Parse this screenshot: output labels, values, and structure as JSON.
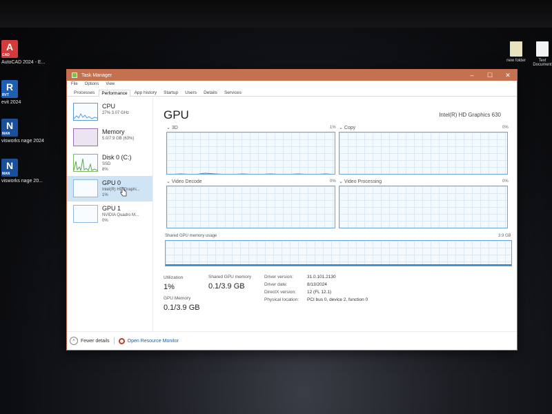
{
  "desktop": {
    "icons": [
      {
        "letter": "A",
        "badge": "CAD",
        "caption": "AutoCAD 2024 - E...",
        "color": "#d33b3b"
      },
      {
        "letter": "R",
        "badge": "RVT",
        "caption": "evit 2024",
        "color": "#1e5fb3"
      },
      {
        "letter": "N",
        "badge": "MAN",
        "caption": "visworks nage 2024",
        "color": "#1a4f9b"
      },
      {
        "letter": "N",
        "badge": "MAN",
        "caption": "visworks nage 20...",
        "color": "#1a4f9b"
      }
    ],
    "right_icons": [
      {
        "caption": "new folder"
      },
      {
        "caption": "Text Document"
      }
    ]
  },
  "window": {
    "title": "Task Manager",
    "controls": {
      "minimize": "–",
      "maximize": "☐",
      "close": "✕"
    },
    "menu": [
      "File",
      "Options",
      "View"
    ],
    "tabs": [
      "Processes",
      "Performance",
      "App history",
      "Startup",
      "Users",
      "Details",
      "Services"
    ],
    "active_tab": "Performance"
  },
  "sidebar": {
    "items": [
      {
        "name": "CPU",
        "sub1": "27%  3.07 GHz",
        "sub2": ""
      },
      {
        "name": "Memory",
        "sub1": "5.0/7.9 GB (63%)",
        "sub2": ""
      },
      {
        "name": "Disk 0 (C:)",
        "sub1": "SSD",
        "sub2": "8%"
      },
      {
        "name": "GPU 0",
        "sub1": "Intel(R) HD Graphi...",
        "sub2": "1%"
      },
      {
        "name": "GPU 1",
        "sub1": "NVIDIA Quadro M...",
        "sub2": "0%"
      }
    ],
    "selected": "GPU 0"
  },
  "main": {
    "heading": "GPU",
    "model": "Intel(R) HD Graphics 630",
    "graphs": [
      {
        "label": "3D",
        "percent": "1%"
      },
      {
        "label": "Copy",
        "percent": "0%"
      },
      {
        "label": "Video Decode",
        "percent": "0%"
      },
      {
        "label": "Video Processing",
        "percent": "0%"
      }
    ],
    "shared_memory": {
      "label": "Shared GPU memory usage",
      "max": "3.9 GB"
    },
    "stats": {
      "utilization_label": "Utilization",
      "utilization": "1%",
      "shared_label": "Shared GPU memory",
      "shared": "0.1/3.9 GB",
      "gpu_memory_label": "GPU Memory",
      "gpu_memory": "0.1/3.9 GB"
    },
    "details": [
      {
        "key": "Driver version:",
        "value": "31.0.101.2130"
      },
      {
        "key": "Driver date:",
        "value": "8/13/2024"
      },
      {
        "key": "DirectX version:",
        "value": "12 (FL 12.1)"
      },
      {
        "key": "Physical location:",
        "value": "PCI bus 0, device 2, function 0"
      }
    ]
  },
  "footer": {
    "fewer_details": "Fewer details",
    "resource_monitor": "Open Resource Monitor"
  }
}
